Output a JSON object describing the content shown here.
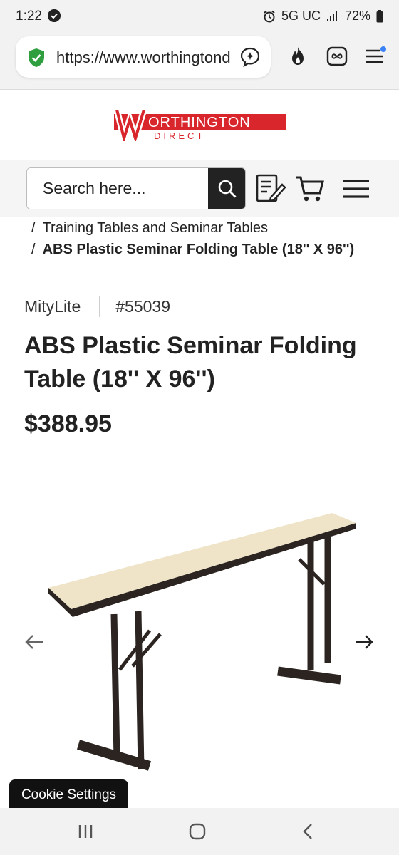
{
  "status_bar": {
    "time": "1:22",
    "network": "5G UC",
    "battery": "72%",
    "icons": [
      "check-circle-icon",
      "alarm-icon",
      "signal-icon",
      "battery-icon"
    ]
  },
  "browser": {
    "url": "https://www.worthingtondirect.com",
    "icons": [
      "shield-check-icon",
      "assistant-icon",
      "fire-icon",
      "tabs-infinity-icon",
      "menu-icon"
    ],
    "colors": {
      "shield": "#2e9e3f",
      "menu_dot": "#3b82f6"
    }
  },
  "logo": {
    "brand_main": "ORTHINGTON",
    "brand_sub": "DIRECT",
    "colors": {
      "red": "#d8262c"
    }
  },
  "search": {
    "placeholder": "Search here...",
    "icons": [
      "search-icon",
      "quote-list-icon",
      "cart-icon",
      "hamburger-menu-icon"
    ]
  },
  "breadcrumb": {
    "separator": "/",
    "items": [
      {
        "label": "Training Tables and Seminar Tables"
      },
      {
        "label": "ABS Plastic Seminar Folding Table (18'' X 96'')"
      }
    ]
  },
  "product": {
    "brand": "MityLite",
    "sku": "#55039",
    "title": "ABS Plastic Seminar Folding Table (18'' X 96'')",
    "price": "$388.95"
  },
  "gallery": {
    "icons": [
      "arrow-left-icon",
      "arrow-right-icon",
      "table-product-image"
    ]
  },
  "cookie": {
    "label": "Cookie Settings"
  },
  "system_nav": {
    "icons": [
      "recents-icon",
      "home-icon",
      "back-icon"
    ]
  }
}
